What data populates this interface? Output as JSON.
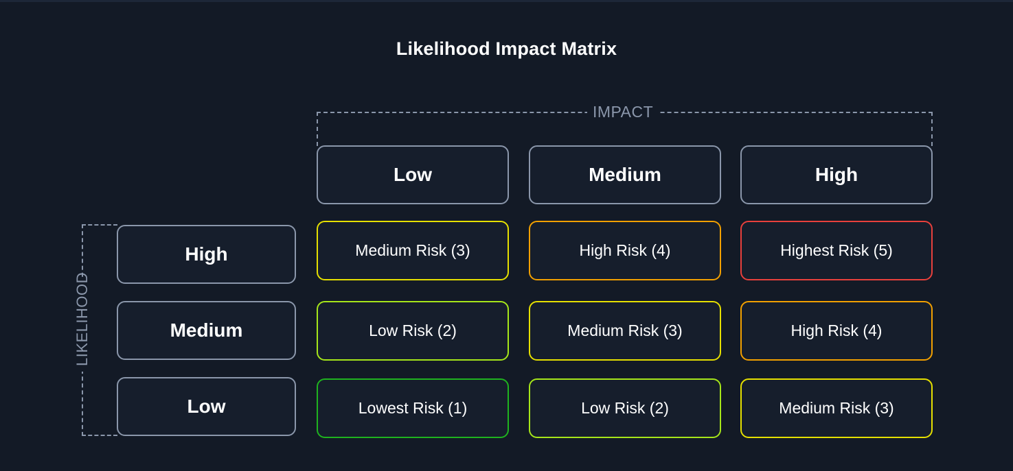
{
  "title": "Likelihood Impact Matrix",
  "impact_axis": {
    "label": "IMPACT",
    "columns": [
      "Low",
      "Medium",
      "High"
    ]
  },
  "likelihood_axis": {
    "label": "LIKELIHOOD",
    "rows": [
      "High",
      "Medium",
      "Low"
    ]
  },
  "risk_colors": {
    "1": "#1fb31f",
    "2": "#a6e61a",
    "3": "#e6e000",
    "4": "#f2a000",
    "5": "#e8403c"
  },
  "matrix": [
    [
      {
        "label": "Medium Risk (3)",
        "level": 3
      },
      {
        "label": "High Risk (4)",
        "level": 4
      },
      {
        "label": "Highest Risk (5)",
        "level": 5
      }
    ],
    [
      {
        "label": "Low Risk (2)",
        "level": 2
      },
      {
        "label": "Medium Risk (3)",
        "level": 3
      },
      {
        "label": "High Risk (4)",
        "level": 4
      }
    ],
    [
      {
        "label": "Lowest Risk (1)",
        "level": 1
      },
      {
        "label": "Low Risk (2)",
        "level": 2
      },
      {
        "label": "Medium Risk (3)",
        "level": 3
      }
    ]
  ]
}
